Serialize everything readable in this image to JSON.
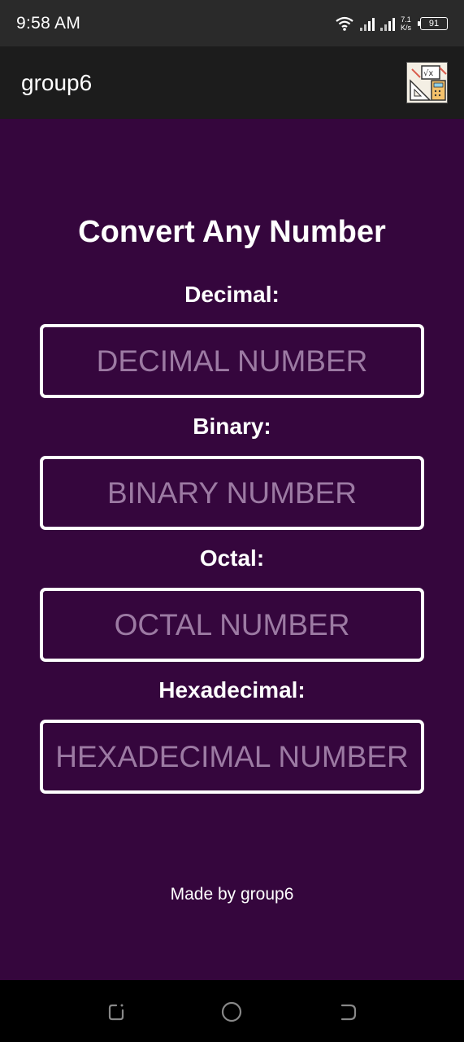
{
  "status_bar": {
    "time": "9:58 AM",
    "speed_value": "7.1",
    "speed_unit": "K/s",
    "battery": "91",
    "wifi_icon": "wifi-icon",
    "signal_icon": "signal-icon"
  },
  "app_bar": {
    "title": "group6",
    "logo_icon": "math-tools-icon"
  },
  "main": {
    "heading": "Convert Any Number",
    "fields": [
      {
        "label": "Decimal:",
        "placeholder": "DECIMAL NUMBER",
        "value": ""
      },
      {
        "label": "Binary:",
        "placeholder": "BINARY NUMBER",
        "value": ""
      },
      {
        "label": "Octal:",
        "placeholder": "OCTAL NUMBER",
        "value": ""
      },
      {
        "label": "Hexadecimal:",
        "placeholder": "HEXADECIMAL NUMBER",
        "value": ""
      }
    ],
    "footer": "Made by group6"
  },
  "nav_bar": {
    "recents_icon": "recents-icon",
    "home_icon": "home-icon",
    "back_icon": "back-icon"
  },
  "colors": {
    "background": "#35063d",
    "app_bar": "#1c1c1c",
    "status_bar": "#2a2a2a",
    "placeholder": "#9c7aa3",
    "border": "#ffffff"
  }
}
